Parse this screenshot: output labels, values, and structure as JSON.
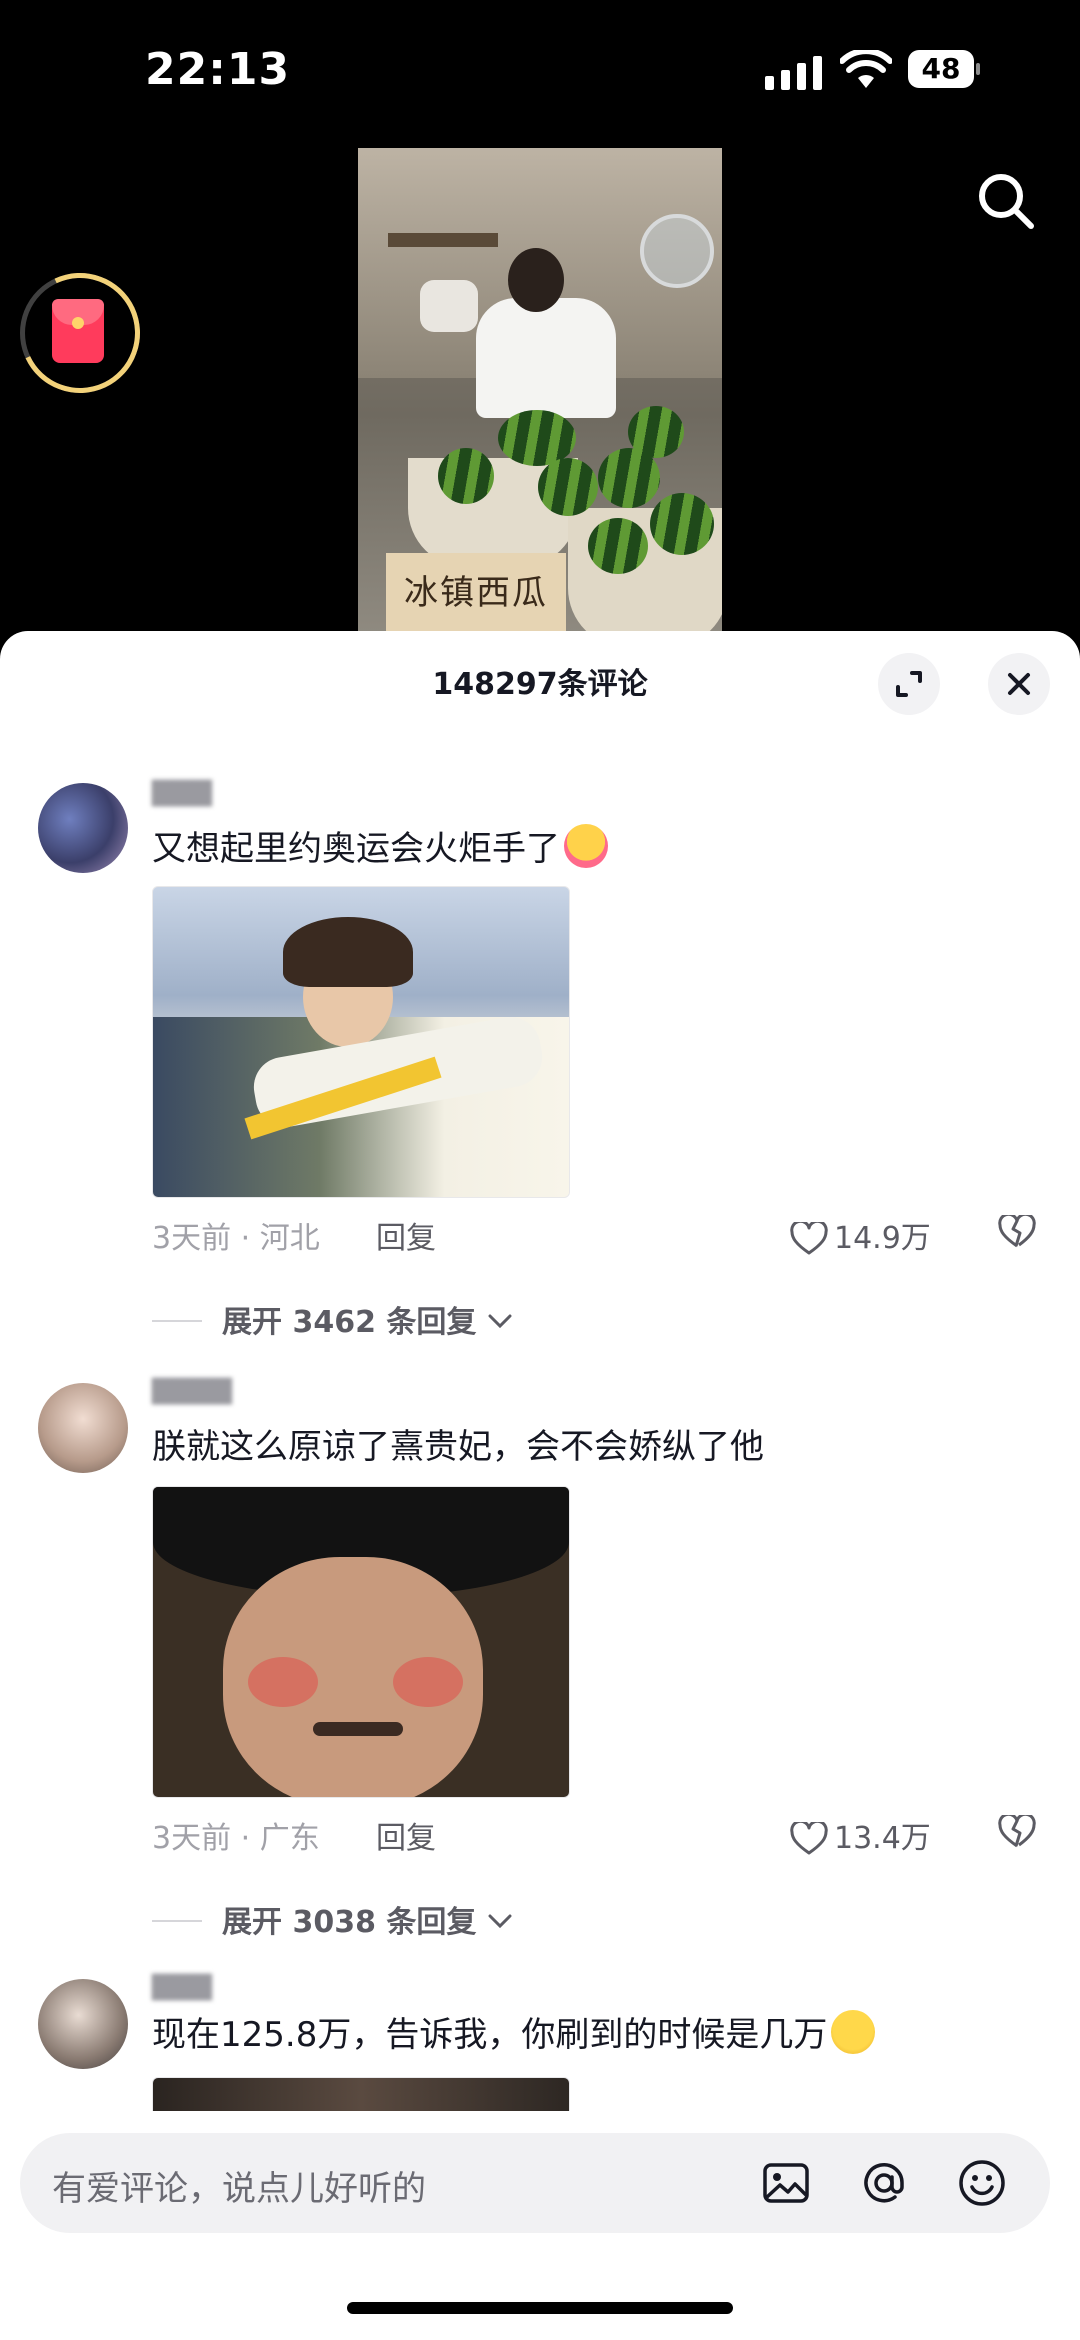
{
  "status_bar": {
    "time": "22:13",
    "battery": "48"
  },
  "video": {
    "sign_text": "冰镇西瓜"
  },
  "sheet": {
    "title": "148297条评论"
  },
  "comments": [
    {
      "text": "又想起里约奥运会火炬手了",
      "meta": "3天前 · 河北",
      "reply_label": "回复",
      "likes": "14.9万",
      "expand_label": "展开 3462 条回复"
    },
    {
      "text": "朕就这么原谅了熹贵妃，会不会娇纵了他",
      "meta": "3天前 · 广东",
      "reply_label": "回复",
      "likes": "13.4万",
      "expand_label": "展开 3038 条回复"
    },
    {
      "text": "现在125.8万，告诉我，你刷到的时候是几万"
    }
  ],
  "input": {
    "placeholder": "有爱评论，说点儿好听的"
  },
  "colors": {
    "accent_red": "#ff3b5c",
    "text_primary": "#161823",
    "text_secondary": "#a1a1a8"
  }
}
